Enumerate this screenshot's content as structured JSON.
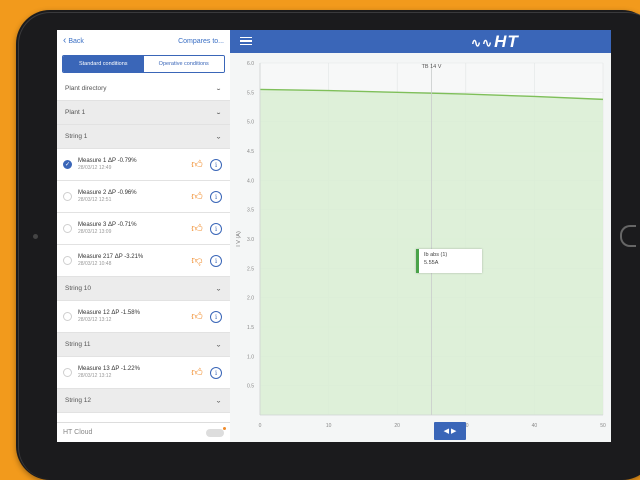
{
  "sidebar": {
    "back_label": "Back",
    "compares_label": "Compares to...",
    "segments": [
      "Standard conditions",
      "Operative conditions"
    ],
    "plant_directory": "Plant directory",
    "plant": "Plant 1",
    "strings": [
      "String 1",
      "String 10",
      "String 11",
      "String 12"
    ],
    "measures": [
      {
        "title": "Measure 1  ΔP -0.79%",
        "date": "28/03/12 12:49"
      },
      {
        "title": "Measure 2  ΔP -0.96%",
        "date": "28/03/12 12:51"
      },
      {
        "title": "Measure 3  ΔP -0.71%",
        "date": "28/03/12 13:09"
      },
      {
        "title": "Measure 217  ΔP -3.21%",
        "date": "28/03/12 10:48"
      },
      {
        "title": "Measure 12  ΔP -1.58%",
        "date": "28/03/12 13:12"
      },
      {
        "title": "Measure 13  ΔP -1.22%",
        "date": "28/03/12 13:12"
      }
    ],
    "footer_label": "HT Cloud"
  },
  "header": {
    "logo_text": "HT"
  },
  "chart_data": {
    "type": "area",
    "title": "TB 14 V",
    "ylabel": "I V (A)",
    "ylim": [
      0,
      6
    ],
    "xlim": [
      0,
      50
    ],
    "yticks": [
      "6.0",
      "5.5",
      "5.0",
      "4.5",
      "4.0",
      "3.5",
      "3.0",
      "2.5",
      "2.0",
      "1.5",
      "1.0",
      "0.5"
    ],
    "xticks": [
      "0",
      "10",
      "20",
      "30",
      "40",
      "50"
    ],
    "series": [
      {
        "x": [
          0,
          10,
          20,
          30,
          40,
          50
        ],
        "y": [
          5.55,
          5.53,
          5.5,
          5.47,
          5.43,
          5.38
        ],
        "color": "#7fbf5a"
      }
    ],
    "tooltip": {
      "label": "Ib abs (1)",
      "value": "5.55A"
    }
  },
  "nav_button_label": "◀ ▶",
  "colors": {
    "accent": "#3a66b8",
    "orange": "#f08c2c",
    "series": "#7fbf5a"
  }
}
